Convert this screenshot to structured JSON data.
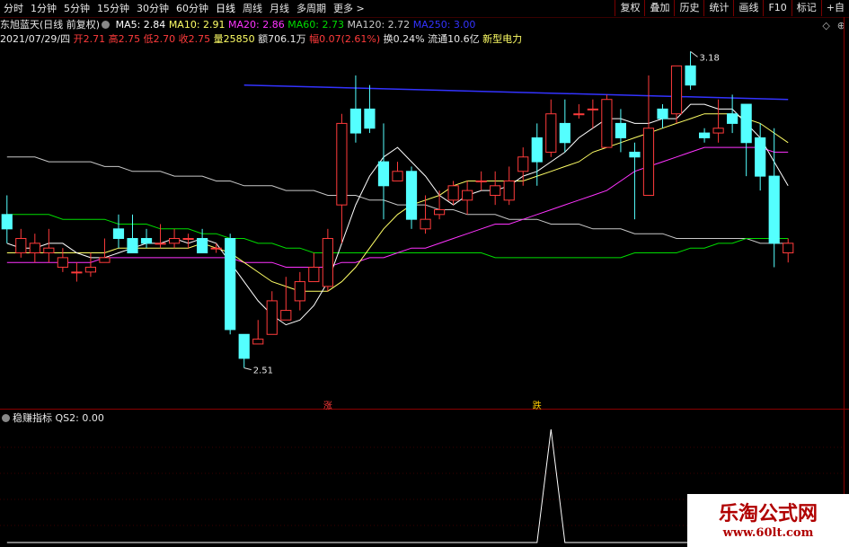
{
  "toolbar": {
    "tabs": [
      "分时",
      "1分钟",
      "5分钟",
      "15分钟",
      "30分钟",
      "60分钟",
      "日线",
      "周线",
      "月线",
      "多周期",
      "更多 >"
    ],
    "active_tab": "日线",
    "right_buttons": [
      "复权",
      "叠加",
      "历史",
      "统计",
      "画线",
      "F10",
      "标记",
      "+自"
    ]
  },
  "info1": {
    "stock": "东旭蓝天(日线 前复权)",
    "ma5": "MA5: 2.84",
    "ma10": "MA10: 2.91",
    "ma20": "MA20: 2.86",
    "ma60": "MA60: 2.73",
    "ma120": "MA120: 2.72",
    "ma250": "MA250: 3.00"
  },
  "info2": {
    "date": "2021/07/29/四",
    "open": "开2.71",
    "high": "高2.75",
    "low": "低2.70",
    "close": "收2.75",
    "volume": "量25850",
    "amount": "额706.1万",
    "change": "幅0.07(2.61%)",
    "turnover": "换0.24%",
    "float": "流通10.6亿",
    "sector": "新型电力"
  },
  "corner_icons": [
    "◇",
    "⊕"
  ],
  "indicator": {
    "name": "稳赚指标",
    "value": "QS2: 0.00"
  },
  "annotations": {
    "high_label": "3.18",
    "low_label": "2.51",
    "mark_zhang": "涨",
    "mark_die": "跌"
  },
  "watermark": {
    "title": "乐淘公式网",
    "url": "www.60lt.com"
  },
  "colors": {
    "up": "#ff3b3b",
    "down": "#54ffff",
    "ma5": "#ffffff",
    "ma10": "#ffff66",
    "ma20": "#ff33ff",
    "ma60": "#00dd00",
    "ma120": "#c8c8c8",
    "ma250": "#3333ff"
  },
  "chart_data": {
    "type": "candlestick",
    "ylim": [
      2.48,
      3.22
    ],
    "candles": [
      [
        2.87,
        2.84,
        2.91,
        2.81
      ],
      [
        2.79,
        2.82,
        2.84,
        2.78
      ],
      [
        2.79,
        2.81,
        2.83,
        2.77
      ],
      [
        2.79,
        2.8,
        2.84,
        2.77
      ],
      [
        2.76,
        2.78,
        2.8,
        2.75
      ],
      [
        2.75,
        2.75,
        2.77,
        2.73
      ],
      [
        2.75,
        2.76,
        2.79,
        2.74
      ],
      [
        2.77,
        2.78,
        2.82,
        2.77
      ],
      [
        2.84,
        2.82,
        2.87,
        2.8
      ],
      [
        2.82,
        2.79,
        2.87,
        2.79
      ],
      [
        2.82,
        2.81,
        2.84,
        2.8
      ],
      [
        2.81,
        2.81,
        2.85,
        2.8
      ],
      [
        2.81,
        2.82,
        2.84,
        2.8
      ],
      [
        2.82,
        2.82,
        2.83,
        2.8
      ],
      [
        2.82,
        2.79,
        2.84,
        2.79
      ],
      [
        2.8,
        2.8,
        2.81,
        2.79
      ],
      [
        2.82,
        2.63,
        2.83,
        2.62
      ],
      [
        2.62,
        2.57,
        2.62,
        2.55
      ],
      [
        2.6,
        2.61,
        2.65,
        2.6
      ],
      [
        2.62,
        2.69,
        2.71,
        2.62
      ],
      [
        2.65,
        2.67,
        2.74,
        2.65
      ],
      [
        2.69,
        2.73,
        2.75,
        2.67
      ],
      [
        2.73,
        2.76,
        2.79,
        2.73
      ],
      [
        2.72,
        2.82,
        2.84,
        2.71
      ],
      [
        2.89,
        3.06,
        3.08,
        2.81
      ],
      [
        3.09,
        3.04,
        3.16,
        3.02
      ],
      [
        3.09,
        3.05,
        3.14,
        3.04
      ],
      [
        2.98,
        2.93,
        3.06,
        2.86
      ],
      [
        2.94,
        2.96,
        2.98,
        2.94
      ],
      [
        2.96,
        2.86,
        2.97,
        2.84
      ],
      [
        2.84,
        2.86,
        2.91,
        2.83
      ],
      [
        2.87,
        2.88,
        2.92,
        2.86
      ],
      [
        2.9,
        2.93,
        2.94,
        2.89
      ],
      [
        2.9,
        2.92,
        2.94,
        2.87
      ],
      [
        2.94,
        2.94,
        2.96,
        2.92
      ],
      [
        2.91,
        2.93,
        2.96,
        2.89
      ],
      [
        2.9,
        2.94,
        2.97,
        2.89
      ],
      [
        2.96,
        2.99,
        3.01,
        2.93
      ],
      [
        3.03,
        2.98,
        3.06,
        2.93
      ],
      [
        3.0,
        3.08,
        3.11,
        2.99
      ],
      [
        3.06,
        3.02,
        3.11,
        3.0
      ],
      [
        3.08,
        3.08,
        3.1,
        3.07
      ],
      [
        3.09,
        3.09,
        3.11,
        3.05
      ],
      [
        3.01,
        3.11,
        3.12,
        3.01
      ],
      [
        3.06,
        3.03,
        3.09,
        3.0
      ],
      [
        3.0,
        2.99,
        3.02,
        2.86
      ],
      [
        2.91,
        3.05,
        3.16,
        2.91
      ],
      [
        3.09,
        3.07,
        3.1,
        3.05
      ],
      [
        3.08,
        3.18,
        3.18,
        3.06
      ],
      [
        3.18,
        3.14,
        3.21,
        3.13
      ],
      [
        3.04,
        3.03,
        3.05,
        3.02
      ],
      [
        3.04,
        3.05,
        3.11,
        3.02
      ],
      [
        3.08,
        3.06,
        3.12,
        3.04
      ],
      [
        3.1,
        3.02,
        3.1,
        2.95
      ],
      [
        3.03,
        2.95,
        3.06,
        2.92
      ],
      [
        2.95,
        2.81,
        3.05,
        2.76
      ],
      [
        2.79,
        2.81,
        2.82,
        2.77
      ]
    ],
    "ma5": [
      2.81,
      2.8,
      2.8,
      2.81,
      2.81,
      2.79,
      2.78,
      2.78,
      2.79,
      2.8,
      2.81,
      2.81,
      2.82,
      2.81,
      2.82,
      2.81,
      2.77,
      2.73,
      2.69,
      2.66,
      2.64,
      2.65,
      2.68,
      2.73,
      2.81,
      2.89,
      2.95,
      2.99,
      3.01,
      2.98,
      2.95,
      2.91,
      2.89,
      2.91,
      2.92,
      2.92,
      2.93,
      2.95,
      2.96,
      2.98,
      3.0,
      3.03,
      3.05,
      3.07,
      3.07,
      3.06,
      3.06,
      3.07,
      3.07,
      3.1,
      3.1,
      3.09,
      3.09,
      3.06,
      3.03,
      2.98,
      2.93
    ],
    "ma10": [
      2.79,
      2.79,
      2.79,
      2.79,
      2.79,
      2.79,
      2.79,
      2.79,
      2.8,
      2.8,
      2.8,
      2.8,
      2.8,
      2.8,
      2.81,
      2.8,
      2.79,
      2.77,
      2.75,
      2.73,
      2.72,
      2.71,
      2.71,
      2.71,
      2.73,
      2.76,
      2.8,
      2.84,
      2.87,
      2.89,
      2.9,
      2.91,
      2.93,
      2.94,
      2.94,
      2.94,
      2.94,
      2.94,
      2.95,
      2.96,
      2.97,
      2.98,
      3.0,
      3.01,
      3.02,
      3.03,
      3.04,
      3.05,
      3.06,
      3.07,
      3.08,
      3.08,
      3.08,
      3.07,
      3.06,
      3.04,
      3.02
    ],
    "ma20": [
      2.77,
      2.77,
      2.77,
      2.77,
      2.77,
      2.77,
      2.77,
      2.78,
      2.78,
      2.78,
      2.78,
      2.78,
      2.78,
      2.78,
      2.78,
      2.78,
      2.78,
      2.77,
      2.77,
      2.77,
      2.76,
      2.76,
      2.76,
      2.76,
      2.77,
      2.77,
      2.78,
      2.78,
      2.79,
      2.8,
      2.8,
      2.81,
      2.82,
      2.83,
      2.84,
      2.85,
      2.85,
      2.86,
      2.87,
      2.88,
      2.89,
      2.9,
      2.91,
      2.92,
      2.94,
      2.96,
      2.97,
      2.98,
      2.99,
      3.0,
      3.01,
      3.01,
      3.01,
      3.01,
      3.01,
      3.0,
      3.0
    ],
    "ma60": [
      2.87,
      2.87,
      2.87,
      2.87,
      2.86,
      2.86,
      2.86,
      2.86,
      2.85,
      2.85,
      2.85,
      2.84,
      2.84,
      2.84,
      2.83,
      2.83,
      2.82,
      2.82,
      2.81,
      2.81,
      2.8,
      2.8,
      2.79,
      2.79,
      2.79,
      2.79,
      2.79,
      2.79,
      2.79,
      2.79,
      2.79,
      2.79,
      2.79,
      2.79,
      2.79,
      2.78,
      2.78,
      2.78,
      2.78,
      2.78,
      2.78,
      2.78,
      2.78,
      2.78,
      2.78,
      2.79,
      2.79,
      2.79,
      2.79,
      2.8,
      2.8,
      2.81,
      2.81,
      2.82,
      2.82,
      2.82,
      2.82
    ],
    "ma120": [
      2.99,
      2.99,
      2.99,
      2.98,
      2.98,
      2.98,
      2.98,
      2.97,
      2.97,
      2.96,
      2.96,
      2.96,
      2.95,
      2.95,
      2.95,
      2.94,
      2.94,
      2.93,
      2.93,
      2.93,
      2.92,
      2.92,
      2.92,
      2.91,
      2.91,
      2.91,
      2.9,
      2.9,
      2.89,
      2.89,
      2.89,
      2.88,
      2.88,
      2.87,
      2.87,
      2.87,
      2.86,
      2.86,
      2.86,
      2.85,
      2.85,
      2.85,
      2.84,
      2.84,
      2.84,
      2.83,
      2.83,
      2.83,
      2.82,
      2.82,
      2.82,
      2.82,
      2.82,
      2.82,
      2.81,
      2.81,
      2.81
    ],
    "ma250_segment": {
      "from": 17,
      "to": 56,
      "values": [
        3.14,
        3.11
      ]
    },
    "indicator_qs2": {
      "peak_index": 39,
      "peak_value": 1,
      "other_value": 0
    }
  }
}
